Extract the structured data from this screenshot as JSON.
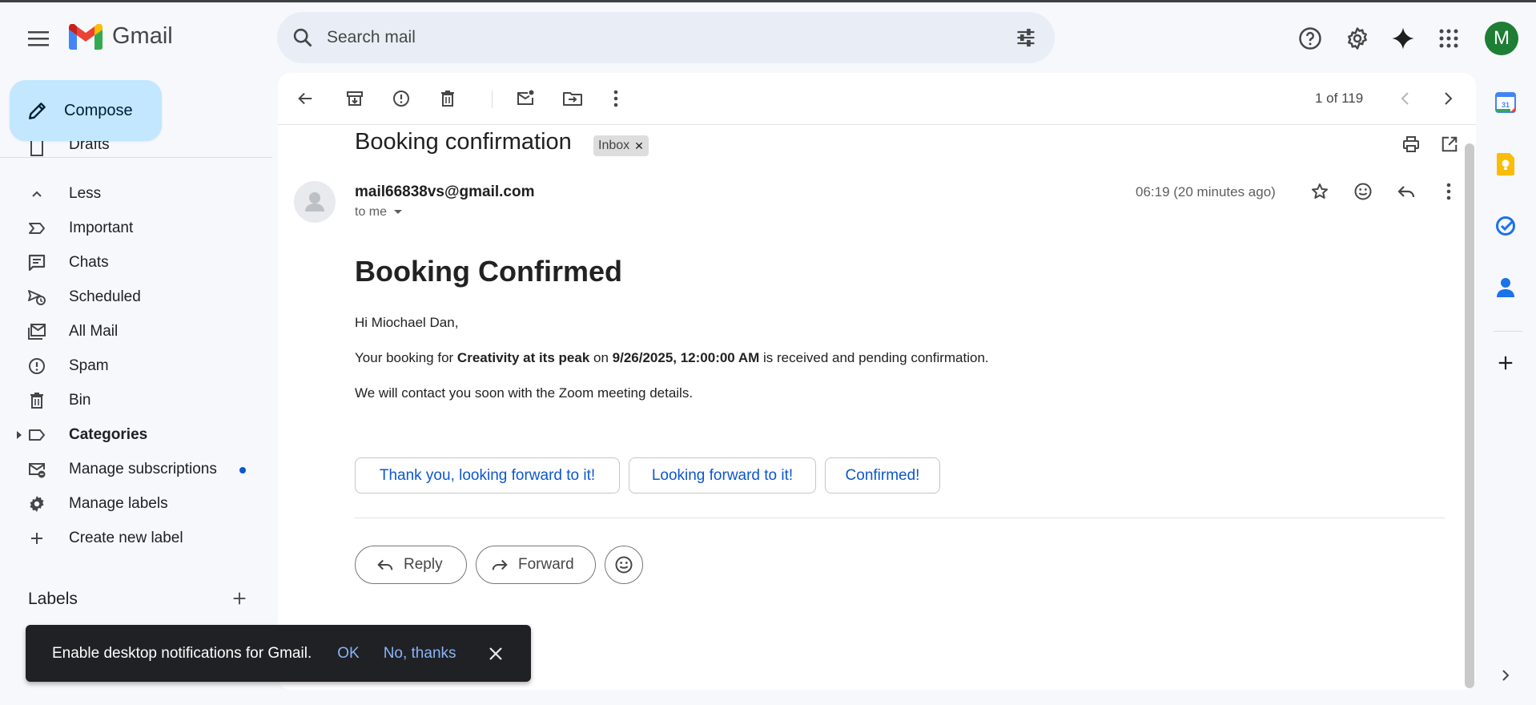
{
  "app": {
    "name": "Gmail",
    "avatar_letter": "M",
    "brand_color": "#ea4335",
    "avatar_color": "#1e7e34"
  },
  "search": {
    "placeholder": "Search mail"
  },
  "compose": {
    "label": "Compose"
  },
  "sidebar": {
    "items": [
      {
        "label": "Drafts",
        "icon": "file-icon"
      },
      {
        "label": "Less",
        "icon": "chevron-up-icon"
      },
      {
        "label": "Important",
        "icon": "important-label-icon"
      },
      {
        "label": "Chats",
        "icon": "chat-icon"
      },
      {
        "label": "Scheduled",
        "icon": "scheduled-send-icon"
      },
      {
        "label": "All Mail",
        "icon": "all-mail-icon"
      },
      {
        "label": "Spam",
        "icon": "spam-icon"
      },
      {
        "label": "Bin",
        "icon": "bin-icon"
      },
      {
        "label": "Categories",
        "icon": "label-icon"
      },
      {
        "label": "Manage subscriptions",
        "icon": "unsubscribe-icon"
      },
      {
        "label": "Manage labels",
        "icon": "gear-icon"
      },
      {
        "label": "Create new label",
        "icon": "plus-icon"
      }
    ],
    "labels_heading": "Labels"
  },
  "toolbar": {
    "pagination": "1 of 119"
  },
  "email": {
    "subject": "Booking confirmation",
    "label_chip": "Inbox",
    "sender": "mail66838vs@gmail.com",
    "recipient": "to me",
    "time": "06:19 (20 minutes ago)",
    "body_heading": "Booking Confirmed",
    "greeting": "Hi Miochael Dan,",
    "line1_pre": "Your booking for ",
    "line1_event": "Creativity at its peak",
    "line1_mid": " on ",
    "line1_date": "9/26/2025, 12:00:00 AM",
    "line1_post": " is received and pending confirmation.",
    "line2": "We will contact you soon with the Zoom meeting details."
  },
  "smart_replies": [
    "Thank you, looking forward to it!",
    "Looking forward to it!",
    "Confirmed!"
  ],
  "actions": {
    "reply": "Reply",
    "forward": "Forward"
  },
  "snackbar": {
    "message": "Enable desktop notifications for Gmail.",
    "ok": "OK",
    "no_thanks": "No, thanks"
  }
}
